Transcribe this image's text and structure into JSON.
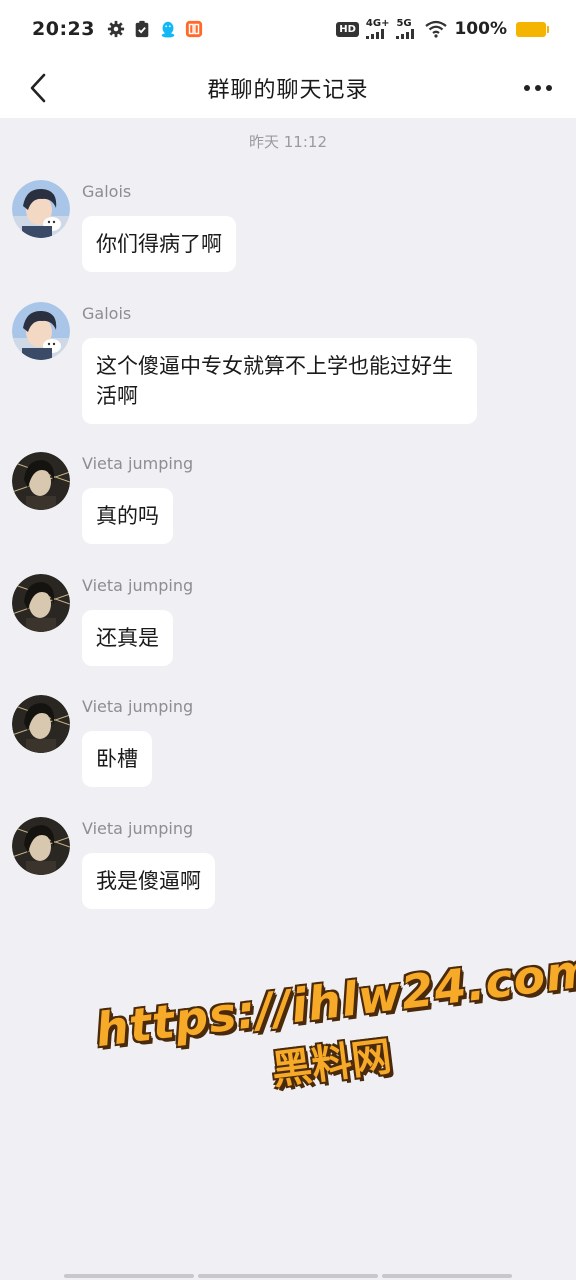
{
  "status_bar": {
    "time": "20:23",
    "hd": "HD",
    "net_4g": "4G+",
    "net_5g": "5G",
    "battery": "100%",
    "battery_color": "#f5b400",
    "left_icons": [
      "gear-icon",
      "clipboard-check-icon",
      "qq-penguin-icon",
      "app-badge-icon"
    ]
  },
  "header": {
    "title": "群聊的聊天记录",
    "back_icon": "chevron-left-icon",
    "more_icon": "more-dots-icon"
  },
  "chat": {
    "timestamp": "昨天 11:12",
    "messages": [
      {
        "sender": "Galois",
        "text": "你们得病了啊"
      },
      {
        "sender": "Galois",
        "text": "这个傻逼中专女就算不上学也能过好生活啊"
      },
      {
        "sender": "Vieta jumping",
        "text": "真的吗"
      },
      {
        "sender": "Vieta jumping",
        "text": "还真是"
      },
      {
        "sender": "Vieta jumping",
        "text": "卧槽"
      },
      {
        "sender": "Vieta jumping",
        "text": "我是傻逼啊"
      }
    ]
  },
  "watermark": {
    "url": "https://ihlw24.com",
    "name": "黑料网",
    "color": "#f7a928"
  }
}
